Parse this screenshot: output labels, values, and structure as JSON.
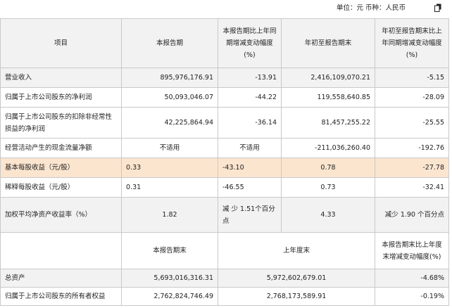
{
  "unit_label": "单位：元  币种：人民币",
  "header": {
    "item": "项目",
    "current": "本报告期",
    "yoy": "本报告期比上年同期增减变动幅度(%)",
    "ytd": "年初至报告期末",
    "ytd_yoy": "年初至报告期末比上年同期增减变动幅度(%)"
  },
  "rows": [
    {
      "item": "营业收入",
      "current": "895,976,176.91",
      "yoy": "-13.91",
      "ytd": "2,416,109,070.21",
      "ytd_yoy": "-5.15"
    },
    {
      "item": "归属于上市公司股东的净利润",
      "current": "50,093,046.07",
      "yoy": "-44.22",
      "ytd": "119,558,640.85",
      "ytd_yoy": "-28.09"
    },
    {
      "item": "归属于上市公司股东的扣除非经常性损益的净利润",
      "current": "42,225,864.94",
      "yoy": "-36.14",
      "ytd": "81,457,255.22",
      "ytd_yoy": "-25.55"
    },
    {
      "item": "经营活动产生的现金流量净额",
      "current": "不适用",
      "yoy": "不适用",
      "ytd": "-211,036,260.40",
      "ytd_yoy": "-192.76"
    },
    {
      "item": "基本每股收益（元/股）",
      "current": "0.33",
      "yoy": "-43.10",
      "ytd": "0.78",
      "ytd_yoy": "-27.78"
    },
    {
      "item": "稀释每股收益（元/股）",
      "current": "0.31",
      "yoy": "-46.55",
      "ytd": "0.73",
      "ytd_yoy": "-32.41"
    },
    {
      "item": "加权平均净资产收益率（%）",
      "current": "1.82",
      "yoy": "减 少 1.51个百分点",
      "ytd": "4.33",
      "ytd_yoy": "减少 1.90 个百分点"
    }
  ],
  "header2": {
    "period_end": "本报告期末",
    "last_year_end": "上年度末",
    "change": "本报告期末比上年度末增减变动幅度(%)"
  },
  "rows2": [
    {
      "item": "总资产",
      "period_end": "5,693,016,316.31",
      "last_year_end": "5,972,602,679.01",
      "change": "-4.68%"
    },
    {
      "item": "归属于上市公司股东的所有者权益",
      "period_end": "2,762,824,746.49",
      "last_year_end": "2,768,173,589.91",
      "change": "-0.19%"
    }
  ],
  "icons": {
    "copy": "copy-icon"
  }
}
